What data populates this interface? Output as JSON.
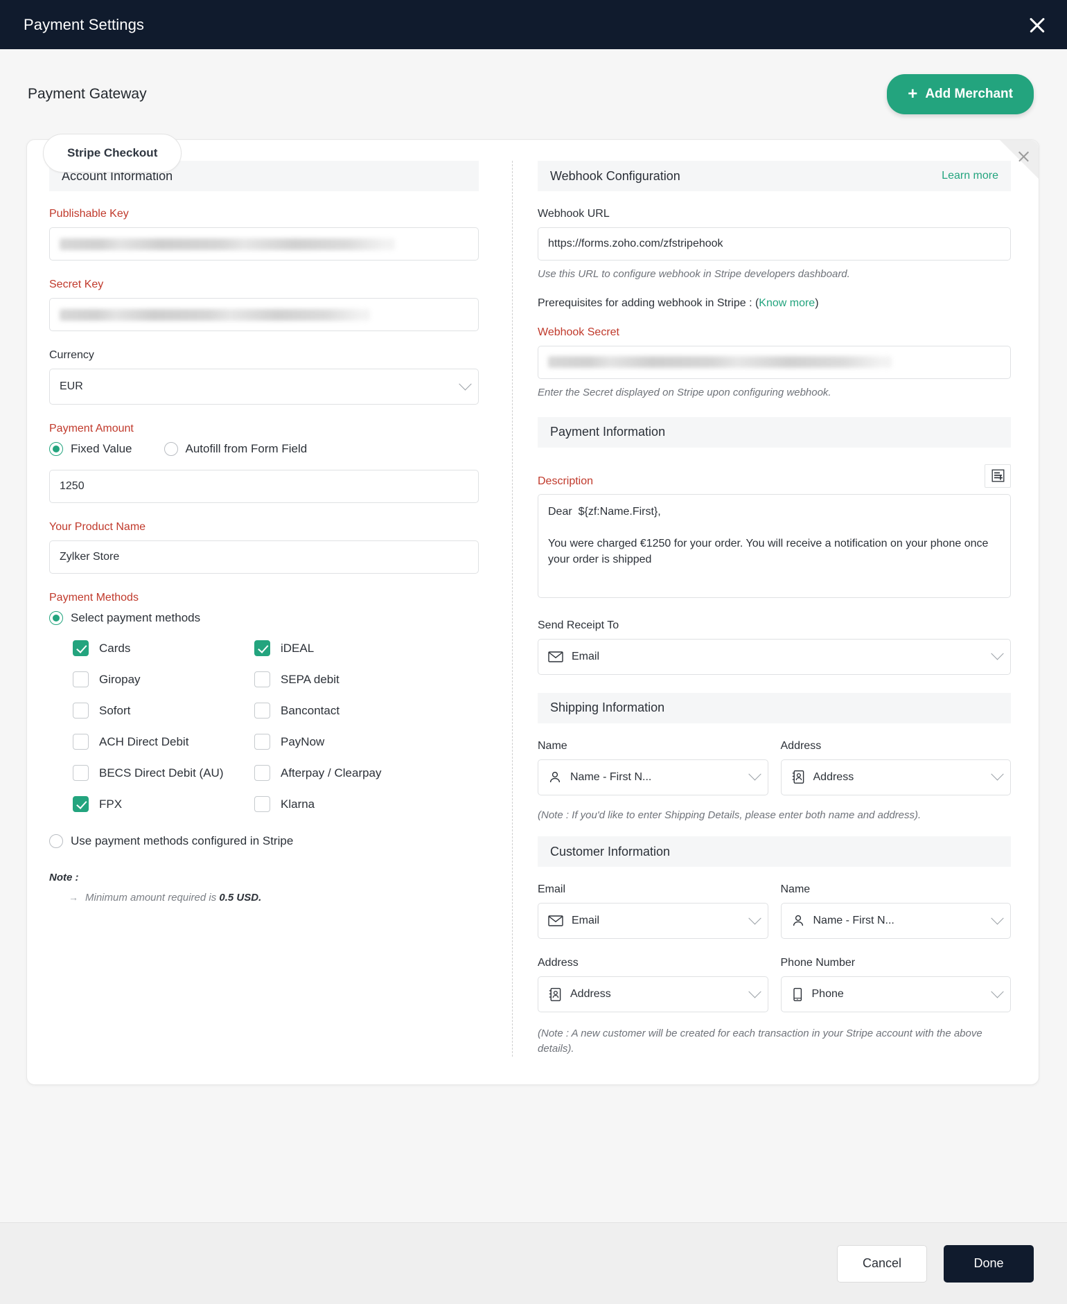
{
  "window": {
    "title": "Payment Settings",
    "close_icon": "close-icon"
  },
  "page": {
    "title": "Payment Gateway",
    "add_merchant_label": "Add Merchant",
    "plus": "+"
  },
  "tabs": [
    {
      "label": "Stripe Checkout",
      "active": true
    }
  ],
  "card": {
    "corner_close_icon": "close-icon"
  },
  "account_information": {
    "heading": "Account Information",
    "publishable_key": {
      "label": "Publishable Key",
      "required": true,
      "value": "",
      "masked": true
    },
    "secret_key": {
      "label": "Secret Key",
      "required": true,
      "value": "",
      "masked": true
    },
    "currency": {
      "label": "Currency",
      "value": "EUR",
      "icon": "chevron-down-icon"
    },
    "payment_amount": {
      "label": "Payment Amount",
      "required": true,
      "options": [
        {
          "label": "Fixed Value",
          "selected": true
        },
        {
          "label": "Autofill from Form Field",
          "selected": false
        }
      ],
      "value": "1250"
    },
    "product_name": {
      "label": "Your Product Name",
      "required": true,
      "value": "Zylker Store"
    },
    "payment_methods": {
      "label": "Payment Methods",
      "mode_options": [
        {
          "label": "Select payment methods",
          "selected": true
        },
        {
          "label": "Use payment methods configured in Stripe",
          "selected": false
        }
      ],
      "left_column": [
        {
          "label": "Cards",
          "checked": true
        },
        {
          "label": "Giropay",
          "checked": false
        },
        {
          "label": "Sofort",
          "checked": false
        },
        {
          "label": "ACH Direct Debit",
          "checked": false
        },
        {
          "label": "BECS Direct Debit (AU)",
          "checked": false
        },
        {
          "label": "FPX",
          "checked": true
        }
      ],
      "right_column": [
        {
          "label": "iDEAL",
          "checked": true
        },
        {
          "label": "SEPA debit",
          "checked": false
        },
        {
          "label": "Bancontact",
          "checked": false
        },
        {
          "label": "PayNow",
          "checked": false
        },
        {
          "label": "Afterpay / Clearpay",
          "checked": false
        },
        {
          "label": "Klarna",
          "checked": false
        }
      ]
    },
    "note": {
      "title": "Note :",
      "arrow": "→",
      "text_prefix": "Minimum amount required is ",
      "text_bold": "0.5 USD."
    }
  },
  "webhook_configuration": {
    "heading": "Webhook Configuration",
    "learn_more": "Learn more",
    "url": {
      "label": "Webhook URL",
      "value": "https://forms.zoho.com/zfstripehook"
    },
    "url_hint": "Use this URL to configure webhook in Stripe developers dashboard.",
    "prereq_text": "Prerequisites for adding webhook in Stripe : (",
    "prereq_link": "Know more",
    "prereq_close": ")",
    "secret": {
      "label": "Webhook Secret",
      "required": true,
      "value": "",
      "masked": true
    },
    "secret_hint": "Enter the Secret displayed on Stripe upon configuring webhook."
  },
  "payment_information": {
    "heading": "Payment Information",
    "description": {
      "label": "Description",
      "required": true,
      "insert_icon": "insert-field-icon",
      "value": "Dear  ${zf:Name.First},\n\nYou were charged €1250 for your order. You will receive a notification on your phone once your order is shipped"
    },
    "send_receipt_to": {
      "label": "Send Receipt To",
      "value": "Email",
      "icon": "email-icon",
      "chevron": "chevron-down-icon"
    }
  },
  "shipping_information": {
    "heading": "Shipping Information",
    "name": {
      "label": "Name",
      "value": "Name - First N...",
      "icon": "person-icon"
    },
    "address": {
      "label": "Address",
      "value": "Address",
      "icon": "address-book-icon"
    },
    "note": "(Note : If you'd like to enter Shipping Details, please enter both name and address)."
  },
  "customer_information": {
    "heading": "Customer Information",
    "email": {
      "label": "Email",
      "value": "Email",
      "icon": "email-icon"
    },
    "name": {
      "label": "Name",
      "value": "Name - First N...",
      "icon": "person-icon"
    },
    "address": {
      "label": "Address",
      "value": "Address",
      "icon": "address-book-icon"
    },
    "phone": {
      "label": "Phone Number",
      "value": "Phone",
      "icon": "phone-icon"
    },
    "note": "(Note : A new customer will be created for each transaction in your Stripe account with the above details)."
  },
  "footer": {
    "cancel": "Cancel",
    "done": "Done"
  },
  "colors": {
    "accent": "#23a47e",
    "dark": "#101b2d",
    "required": "#c0392b"
  }
}
